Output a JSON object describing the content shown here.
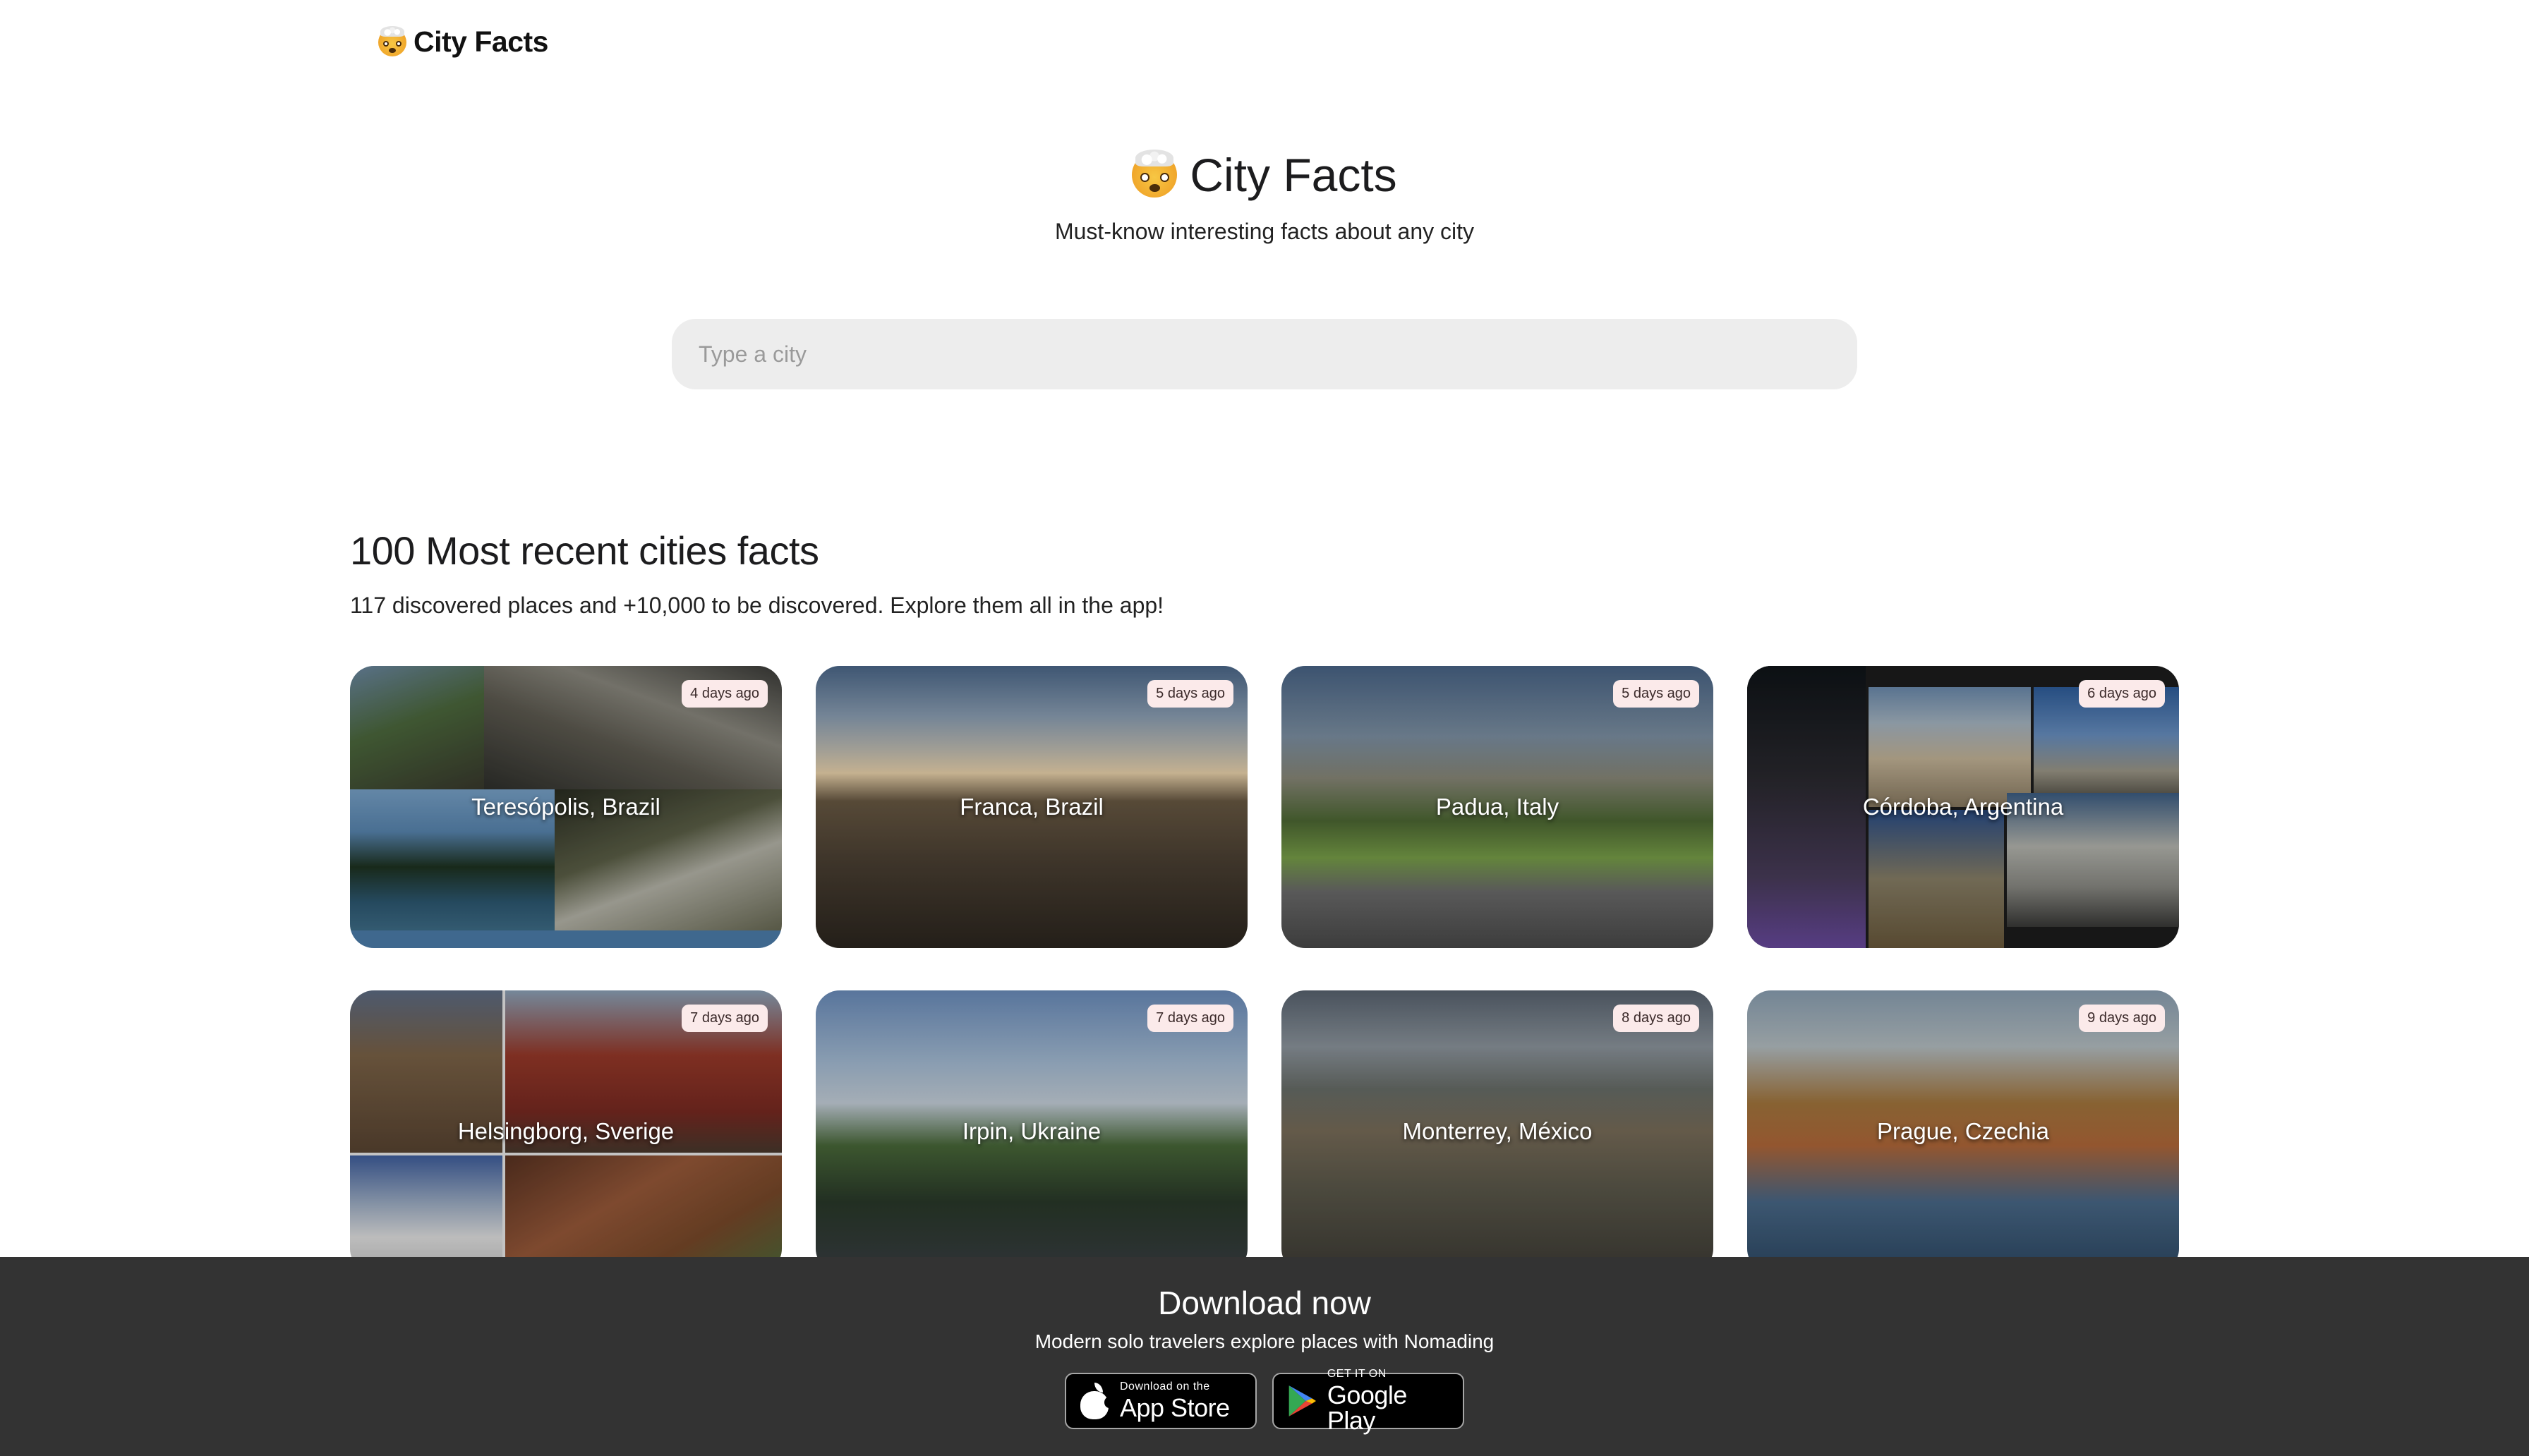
{
  "nav": {
    "brand": "City Facts"
  },
  "hero": {
    "title": "City Facts",
    "subtitle": "Must-know interesting facts about any city"
  },
  "search": {
    "placeholder": "Type a city",
    "value": ""
  },
  "section": {
    "title": "100 Most recent cities facts",
    "subtitle": "117 discovered places and +10,000 to be discovered. Explore them all in the app!"
  },
  "cards": [
    {
      "name": "Teresópolis, Brazil",
      "ago": "4 days ago"
    },
    {
      "name": "Franca, Brazil",
      "ago": "5 days ago"
    },
    {
      "name": "Padua, Italy",
      "ago": "5 days ago"
    },
    {
      "name": "Córdoba, Argentina",
      "ago": "6 days ago"
    },
    {
      "name": "Helsingborg, Sverige",
      "ago": "7 days ago"
    },
    {
      "name": "Irpin, Ukraine",
      "ago": "7 days ago"
    },
    {
      "name": "Monterrey, México",
      "ago": "8 days ago"
    },
    {
      "name": "Prague, Czechia",
      "ago": "9 days ago"
    }
  ],
  "footer": {
    "title": "Download now",
    "subtitle": "Modern solo travelers explore places with Nomading",
    "appstore": {
      "small": "Download on the",
      "big": "App Store"
    },
    "googleplay": {
      "small": "GET IT ON",
      "big": "Google Play"
    }
  },
  "icons": {
    "brand": "exploding-head-emoji",
    "appstore": "apple-logo-icon",
    "googleplay": "google-play-icon"
  }
}
